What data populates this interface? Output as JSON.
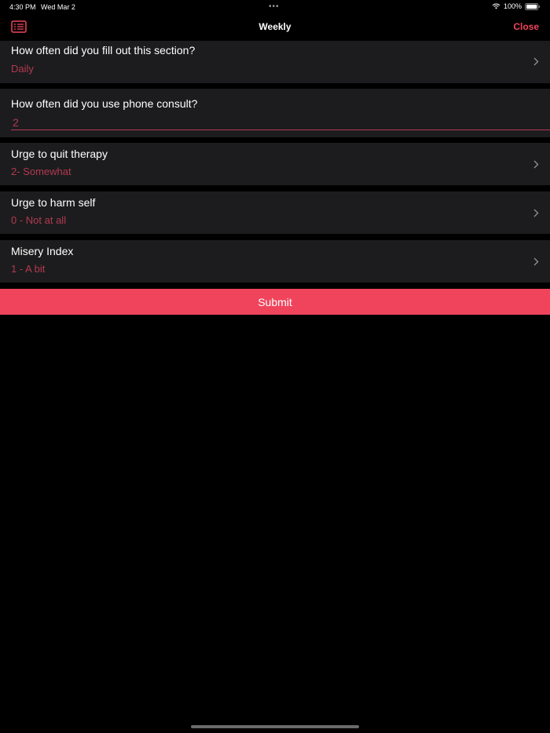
{
  "status_bar": {
    "time": "4:30 PM",
    "date": "Wed Mar 2",
    "dots": "•••",
    "battery": "100%",
    "icons": [
      "wifi-icon",
      "battery-icon"
    ]
  },
  "nav": {
    "title": "Weekly",
    "close_label": "Close",
    "menu_icon": "list-icon"
  },
  "form": {
    "rows": [
      {
        "question": "How often did you fill out this section?",
        "answer": "Daily",
        "type": "picker"
      },
      {
        "question": "How often did you use phone consult?",
        "answer": "2",
        "type": "text-input"
      },
      {
        "question": "Urge to quit therapy",
        "answer": "2- Somewhat",
        "type": "picker"
      },
      {
        "question": "Urge to harm self",
        "answer": "0 - Not at all",
        "type": "picker"
      },
      {
        "question": "Misery Index",
        "answer": "1 - A bit",
        "type": "picker"
      }
    ]
  },
  "submit_label": "Submit",
  "colors": {
    "accent": "#f0445c",
    "answer": "#b23a50",
    "row_background": "#1c1c1e",
    "background": "#000000"
  }
}
